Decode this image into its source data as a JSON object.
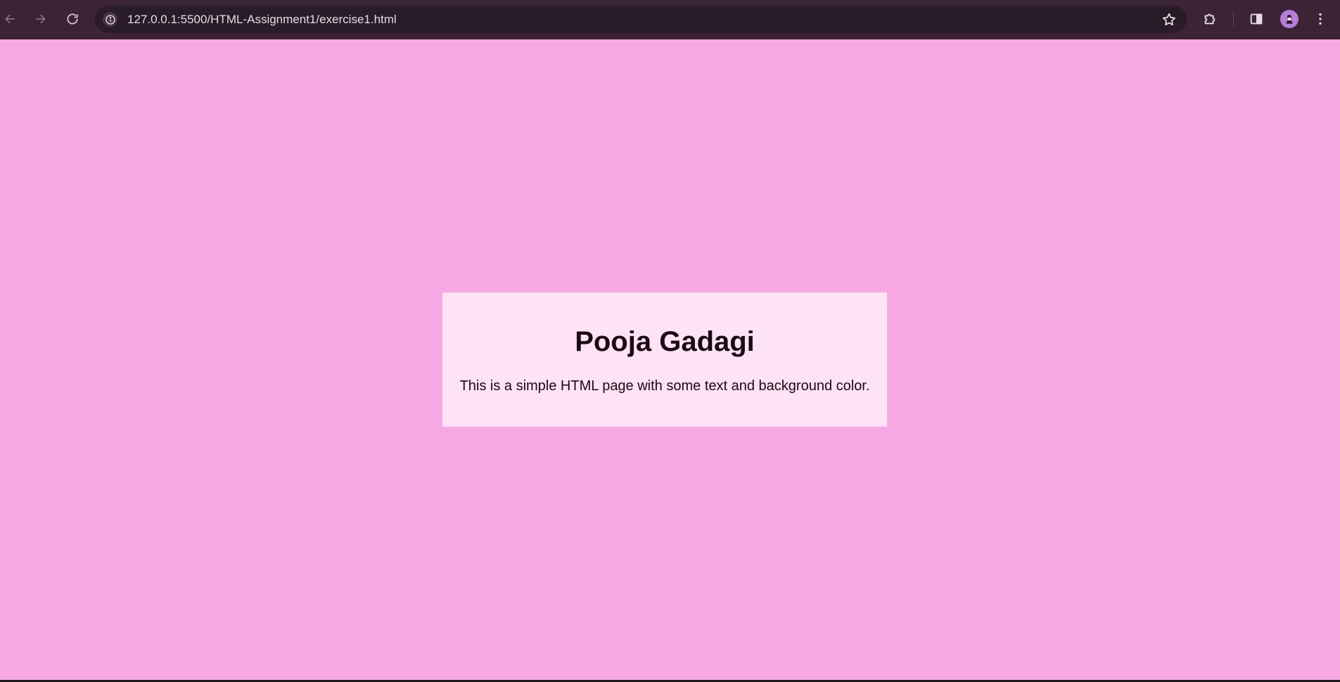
{
  "browser": {
    "url": "127.0.0.1:5500/HTML-Assignment1/exercise1.html",
    "icons": {
      "back": "back-arrow-icon",
      "forward": "forward-arrow-icon",
      "reload": "reload-icon",
      "site_info": "info-icon",
      "bookmark": "star-icon",
      "extensions": "puzzle-icon",
      "side_panel": "side-panel-icon",
      "profile": "avatar",
      "menu": "kebab-menu-icon"
    }
  },
  "page": {
    "background_color": "#f7a8e2",
    "card_color": "#fde3f5",
    "heading": "Pooja Gadagi",
    "paragraph": "This is a simple HTML page with some text and background color."
  }
}
